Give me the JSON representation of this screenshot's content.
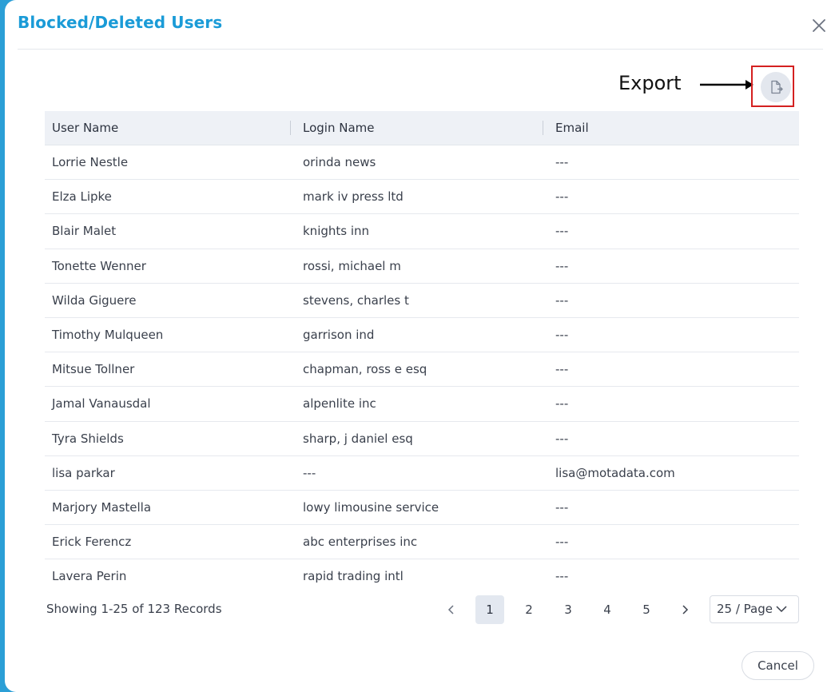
{
  "modal": {
    "title": "Blocked/Deleted Users",
    "export_label": "Export"
  },
  "table": {
    "columns": [
      "User Name",
      "Login Name",
      "Email"
    ],
    "rows": [
      [
        "Lorrie Nestle",
        "orinda news",
        "---"
      ],
      [
        "Elza Lipke",
        "mark iv press ltd",
        "---"
      ],
      [
        "Blair Malet",
        "knights inn",
        "---"
      ],
      [
        "Tonette Wenner",
        "rossi, michael m",
        "---"
      ],
      [
        "Wilda Giguere",
        "stevens, charles t",
        "---"
      ],
      [
        "Timothy Mulqueen",
        "garrison ind",
        "---"
      ],
      [
        "Mitsue Tollner",
        "chapman, ross e esq",
        "---"
      ],
      [
        "Jamal Vanausdal",
        "alpenlite inc",
        "---"
      ],
      [
        "Tyra Shields",
        "sharp, j daniel esq",
        "---"
      ],
      [
        "lisa parkar",
        "---",
        "lisa@motadata.com"
      ],
      [
        "Marjory Mastella",
        "lowy limousine service",
        "---"
      ],
      [
        "Erick Ferencz",
        "abc enterprises inc",
        "---"
      ],
      [
        "Lavera Perin",
        "rapid trading intl",
        "---"
      ]
    ]
  },
  "footer": {
    "records_text": "Showing 1-25 of 123 Records",
    "pages": [
      "1",
      "2",
      "3",
      "4",
      "5"
    ],
    "active_page": "1",
    "page_size": "25 / Page",
    "cancel_label": "Cancel"
  },
  "colors": {
    "accent": "#1a9bd7",
    "highlight_frame": "#d42020"
  },
  "icons": {
    "close": "close-icon",
    "export": "file-export-icon",
    "prev": "chevron-left-icon",
    "next": "chevron-right-icon",
    "dropdown": "chevron-down-icon"
  }
}
